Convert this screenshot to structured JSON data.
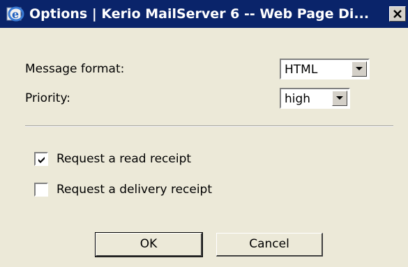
{
  "window": {
    "title": "Options | Kerio MailServer 6 -- Web Page Di...",
    "app_icon": "internet-explorer-icon",
    "close_icon": "close-icon"
  },
  "form": {
    "message_format": {
      "label": "Message format:",
      "selected": "HTML"
    },
    "priority": {
      "label": "Priority:",
      "selected": "high"
    },
    "read_receipt": {
      "label": "Request a read receipt",
      "checked": true
    },
    "delivery_receipt": {
      "label": "Request a delivery receipt",
      "checked": false
    }
  },
  "buttons": {
    "ok_label": "OK",
    "cancel_label": "Cancel"
  },
  "colors": {
    "titlebar": "#0a246a",
    "background": "#ece9d8"
  }
}
